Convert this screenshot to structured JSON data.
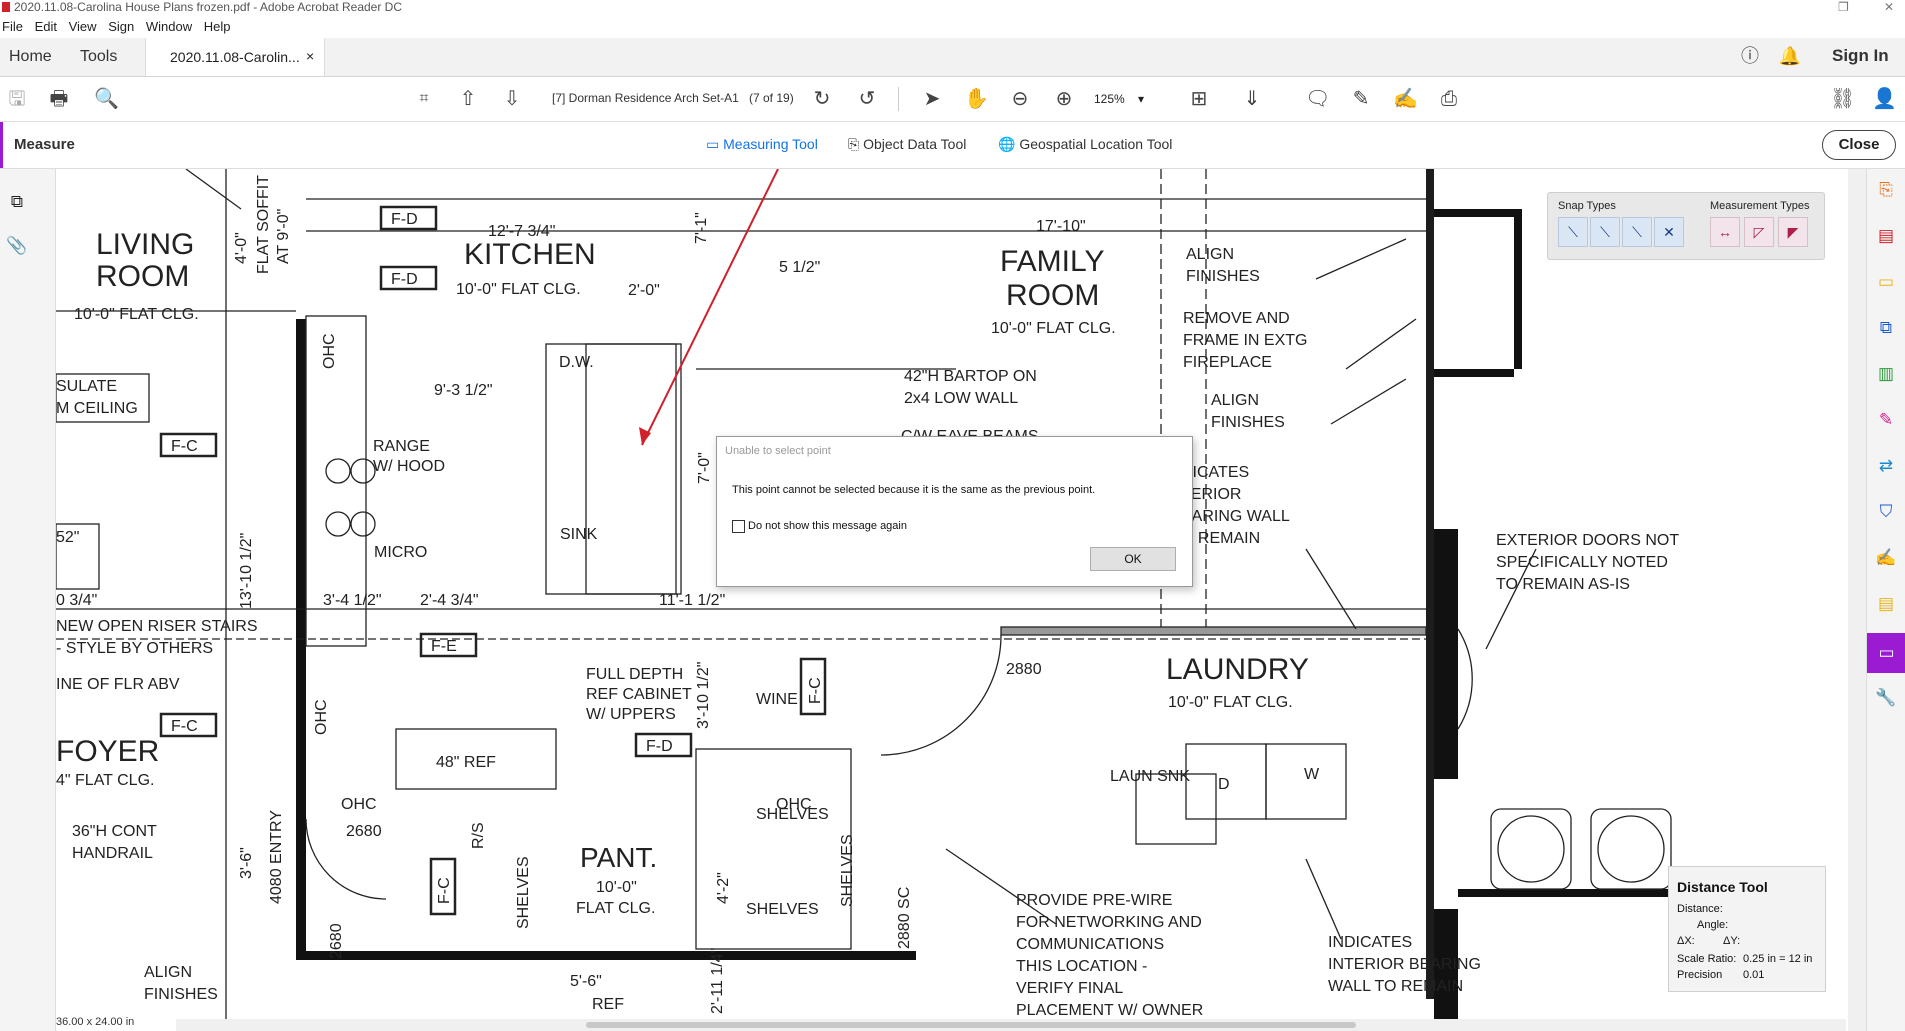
{
  "window": {
    "title": "2020.11.08-Carolina House Plans frozen.pdf - Adobe Acrobat Reader DC"
  },
  "menu": [
    "File",
    "Edit",
    "View",
    "Sign",
    "Window",
    "Help"
  ],
  "tabs": {
    "home": "Home",
    "tools": "Tools",
    "document": "2020.11.08-Carolin...",
    "close_glyph": "×",
    "sign_in": "Sign In"
  },
  "toolbar": {
    "page_label": "[7] Dorman Residence Arch Set-A1",
    "page_count": "(7 of 19)",
    "zoom": "125%"
  },
  "measure": {
    "title": "Measure",
    "measuring_tool": "Measuring Tool",
    "object_data_tool": "Object Data Tool",
    "geospatial_tool": "Geospatial Location Tool",
    "close": "Close"
  },
  "snap_panel": {
    "snap_types": "Snap Types",
    "measurement_types": "Measurement Types"
  },
  "distance_panel": {
    "title": "Distance Tool",
    "distance": "Distance:",
    "angle": "Angle:",
    "dx": "ΔX:",
    "dy": "ΔY:",
    "scale_ratio_label": "Scale Ratio:",
    "scale_ratio": "0.25 in = 12 in",
    "precision_label": "Precision",
    "precision": "0.01"
  },
  "dialog": {
    "title": "Unable to select point",
    "message": "This point cannot be selected because it is the same as the previous point.",
    "checkbox": "Do not show this message again",
    "ok": "OK"
  },
  "status": {
    "page_size": "36.00 x 24.00 in"
  },
  "drawing": {
    "living_room": "LIVING",
    "living_room2": "ROOM",
    "living_clg": "10'-0\" FLAT CLG.",
    "kitchen": "KITCHEN",
    "kitchen_clg": "10'-0\" FLAT CLG.",
    "family": "FAMILY",
    "family2": "ROOM",
    "family_clg": "10'-0\" FLAT CLG.",
    "laundry": "LAUNDRY",
    "laundry_clg": "10'-0\" FLAT CLG.",
    "foyer": "FOYER",
    "foyer_clg": "4\" FLAT CLG.",
    "pant": "PANT.",
    "pant_clg": "10'-0\"",
    "pant_clg2": "FLAT CLG.",
    "dim_12_7": "12'-7 3/4\"",
    "dim_17_10": "17'-10\"",
    "dim_5_half": "5 1/2\"",
    "dim_2_0": "2'-0\"",
    "dim_9_3": "9'-3 1/2\"",
    "dim_3_4": "3'-4 1/2\"",
    "dim_2_4": "2'-4 3/4\"",
    "dim_11_1": "11'-1 1/2\"",
    "dim_13_10": "13'-10 1/2\"",
    "dim_4_0": "4'-0\"",
    "dim_7_0": "7'-0\"",
    "dim_7_1": "7'-1\"",
    "dim_3_6": "3'-6\"",
    "dim_4_2": "4'-2\"",
    "dim_3_10": "3'-10 1/2\"",
    "dim_5_6": "5'-6\"",
    "dim_2_11": "2'-11 1/4\"",
    "flat_soffit": "FLAT SOFFIT",
    "at_9": "AT 9'-0\"",
    "insulate": "SULATE",
    "m_ceiling": "M CEILING",
    "range": "RANGE",
    "w_hood": "W/ HOOD",
    "micro": "MICRO",
    "sink": "SINK",
    "dw": "D.W.",
    "bartop": "42\"H BARTOP ON",
    "low_wall": "2x4 LOW WALL",
    "ohc": "OHC",
    "fd": "F-D",
    "fc": "F-C",
    "fe": "F-E",
    "align": "ALIGN",
    "finishes": "FINISHES",
    "remove": "REMOVE AND",
    "frame": "FRAME IN EXTG",
    "fireplace": "FIREPLACE",
    "indicates": "DICATES",
    "interior": "TERIOR",
    "bearing": "EARING WALL",
    "remain": "O REMAIN",
    "ext_doors": "EXTERIOR DOORS NOT",
    "spec_noted": "SPECIFICALLY NOTED",
    "to_remain": "TO REMAIN AS-IS",
    "stairs": "NEW OPEN RISER STAIRS",
    "style": "- STYLE BY OTHERS",
    "line_flr": "INE OF FLR ABV",
    "dim_52": "52\"",
    "dim_34": "0 3/4\"",
    "full_depth": "FULL DEPTH",
    "ref_cabinet": "REF CABINET",
    "w_uppers": "W/ UPPERS",
    "ref48": "48\" REF",
    "wine": "WINE",
    "shelves": "SHELVES",
    "d2880": "2880",
    "d2680": "2680",
    "entry": "4080 ENTRY",
    "rs": "R/S",
    "sc": "2880 SC",
    "laun_sink": "LAUN SNK",
    "d": "D",
    "w": "W",
    "ref": "REF",
    "handrail": "36\"H CONT",
    "handrail2": "HANDRAIL",
    "prewire1": "PROVIDE PRE-WIRE",
    "prewire2": "FOR NETWORKING AND",
    "prewire3": "COMMUNICATIONS",
    "prewire4": "THIS LOCATION -",
    "prewire5": "VERIFY FINAL",
    "prewire6": "PLACEMENT W/ OWNER",
    "ind_bearing1": "INDICATES",
    "ind_bearing2": "INTERIOR BEARING",
    "ind_bearing3": "WALL TO REMAIN",
    "eave": "C/W EAVE BEAMS",
    "dim_0": "0\""
  }
}
